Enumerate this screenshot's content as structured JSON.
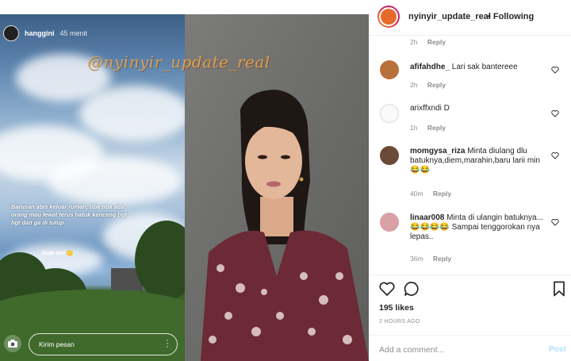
{
  "story": {
    "username": "hanggini",
    "time": "45 menit",
    "text": "Barusan abis keluar rumah, tiba tiba ada orang mau lewat terus batuk kenceng bgt bgt dan ga di tutup.",
    "text2": "Auto lari",
    "message_placeholder": "Kirim pesan"
  },
  "watermark": "@nyinyir_update_real",
  "post": {
    "username": "nyinyir_update_real",
    "follow_label": "• Following"
  },
  "top_meta": {
    "age": "2h",
    "reply_label": "Reply"
  },
  "comments": [
    {
      "username": "afifahdhe_",
      "text": "Lari sak bantereee",
      "age": "2h",
      "reply_label": "Reply"
    },
    {
      "username": "arixffxndi",
      "text": "D",
      "age": "1h",
      "reply_label": "Reply"
    },
    {
      "username": "momgysa_riza",
      "text": "Minta diulang dlu batuknya,diem,marahin,baru larii min 😂😂",
      "age": "40m",
      "reply_label": "Reply"
    },
    {
      "username": "linaar008",
      "text": "Minta di ulangin batuknya... 😂😂😂😂 Sampai tenggorokan nya lepas..",
      "age": "36m",
      "reply_label": "Reply"
    }
  ],
  "likes": "195 likes",
  "date": "2 HOURS AGO",
  "add_comment_placeholder": "Add a comment...",
  "post_button": "Post",
  "colors": {
    "link_blue_disabled": "#b2dffc",
    "text": "#262626",
    "muted": "#8e8e8e"
  }
}
